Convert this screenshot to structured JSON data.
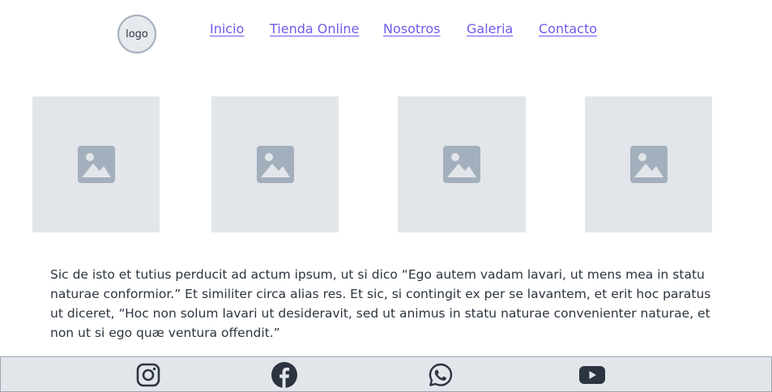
{
  "header": {
    "logo_text": "logo",
    "nav": [
      {
        "label": "Inicio"
      },
      {
        "label": "Tienda Online"
      },
      {
        "label": "Nosotros"
      },
      {
        "label": "Galeria"
      },
      {
        "label": "Contacto"
      }
    ]
  },
  "gallery": {
    "items": [
      {
        "icon": "image-placeholder-icon"
      },
      {
        "icon": "image-placeholder-icon"
      },
      {
        "icon": "image-placeholder-icon"
      },
      {
        "icon": "image-placeholder-icon"
      }
    ]
  },
  "content": {
    "paragraph": "Sic de isto et tutius perducit ad actum ipsum, ut si dico “Ego autem vadam lavari, ut mens mea in statu naturae conformior.” Et similiter circa alias res. Et sic, si contingit ex per se lavantem, et erit hoc paratus ut diceret, “Hoc non solum lavari ut desideravit, sed ut animus in statu naturae convenienter naturae, et non ut si ego quæ ventura offendit.”"
  },
  "footer": {
    "social": [
      {
        "icon": "instagram-icon"
      },
      {
        "icon": "facebook-icon"
      },
      {
        "icon": "whatsapp-icon"
      },
      {
        "icon": "youtube-icon"
      }
    ]
  },
  "colors": {
    "link": "#6d5ce8",
    "placeholder_bg": "#e2e6ea",
    "placeholder_icon": "#a3afbc",
    "footer_bg": "#e2e6ea",
    "icon_dark": "#2b3440"
  }
}
